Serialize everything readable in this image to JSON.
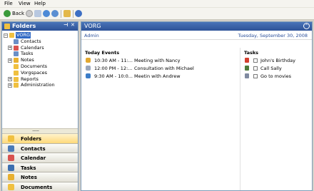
{
  "menu": [
    "File",
    "View",
    "Help"
  ],
  "toolbar": {
    "back_label": "Back"
  },
  "folders_panel": {
    "title": "Folders",
    "tree": [
      {
        "label": "VORG",
        "level": 0,
        "expander": "−",
        "icon": "folder-icon",
        "selected": true
      },
      {
        "label": "Contacts",
        "level": 1,
        "expander": "",
        "icon": "contacts-icon"
      },
      {
        "label": "Calendars",
        "level": 1,
        "expander": "+",
        "icon": "calendar-icon"
      },
      {
        "label": "Tasks",
        "level": 1,
        "expander": "",
        "icon": "tasks-icon"
      },
      {
        "label": "Notes",
        "level": 1,
        "expander": "+",
        "icon": "notes-icon"
      },
      {
        "label": "Documents",
        "level": 1,
        "expander": "",
        "icon": "folder-icon"
      },
      {
        "label": "Vorgspaces",
        "level": 1,
        "expander": "",
        "icon": "folder-icon"
      },
      {
        "label": "Reports",
        "level": 1,
        "expander": "+",
        "icon": "folder-icon"
      },
      {
        "label": "Administration",
        "level": 1,
        "expander": "+",
        "icon": "folder-icon"
      }
    ],
    "nav": [
      {
        "label": "Folders",
        "icon": "folder-icon",
        "color": "#f0c040",
        "active": true
      },
      {
        "label": "Contacts",
        "icon": "contacts-icon",
        "color": "#4a7ab8"
      },
      {
        "label": "Calendar",
        "icon": "calendar-icon",
        "color": "#d9534f"
      },
      {
        "label": "Tasks",
        "icon": "tasks-icon",
        "color": "#3c6fb0"
      },
      {
        "label": "Notes",
        "icon": "notes-icon",
        "color": "#e8b030"
      },
      {
        "label": "Documents",
        "icon": "folder-icon",
        "color": "#f0c040"
      }
    ]
  },
  "main": {
    "title": "VORG",
    "user": "Admin",
    "date": "Tuesday, September 30, 2008",
    "events_title": "Today Events",
    "events": [
      {
        "time": "10:30 AM - 11:...",
        "subject": "Meeting with Nancy",
        "icon": "meeting-icon"
      },
      {
        "time": "12:00 PM - 12:...",
        "subject": "Consultation with Michael",
        "icon": "consultation-icon"
      },
      {
        "time": "9:30 AM - 10:0...",
        "subject": "Meetin with Andrew",
        "icon": "appointment-icon"
      }
    ],
    "tasks_title": "Tasks",
    "tasks": [
      {
        "subject": "John's Birthday",
        "icon": "birthday-icon"
      },
      {
        "subject": "Call Sally",
        "icon": "phone-icon"
      },
      {
        "subject": "Go to movies",
        "icon": "task-icon"
      }
    ]
  }
}
